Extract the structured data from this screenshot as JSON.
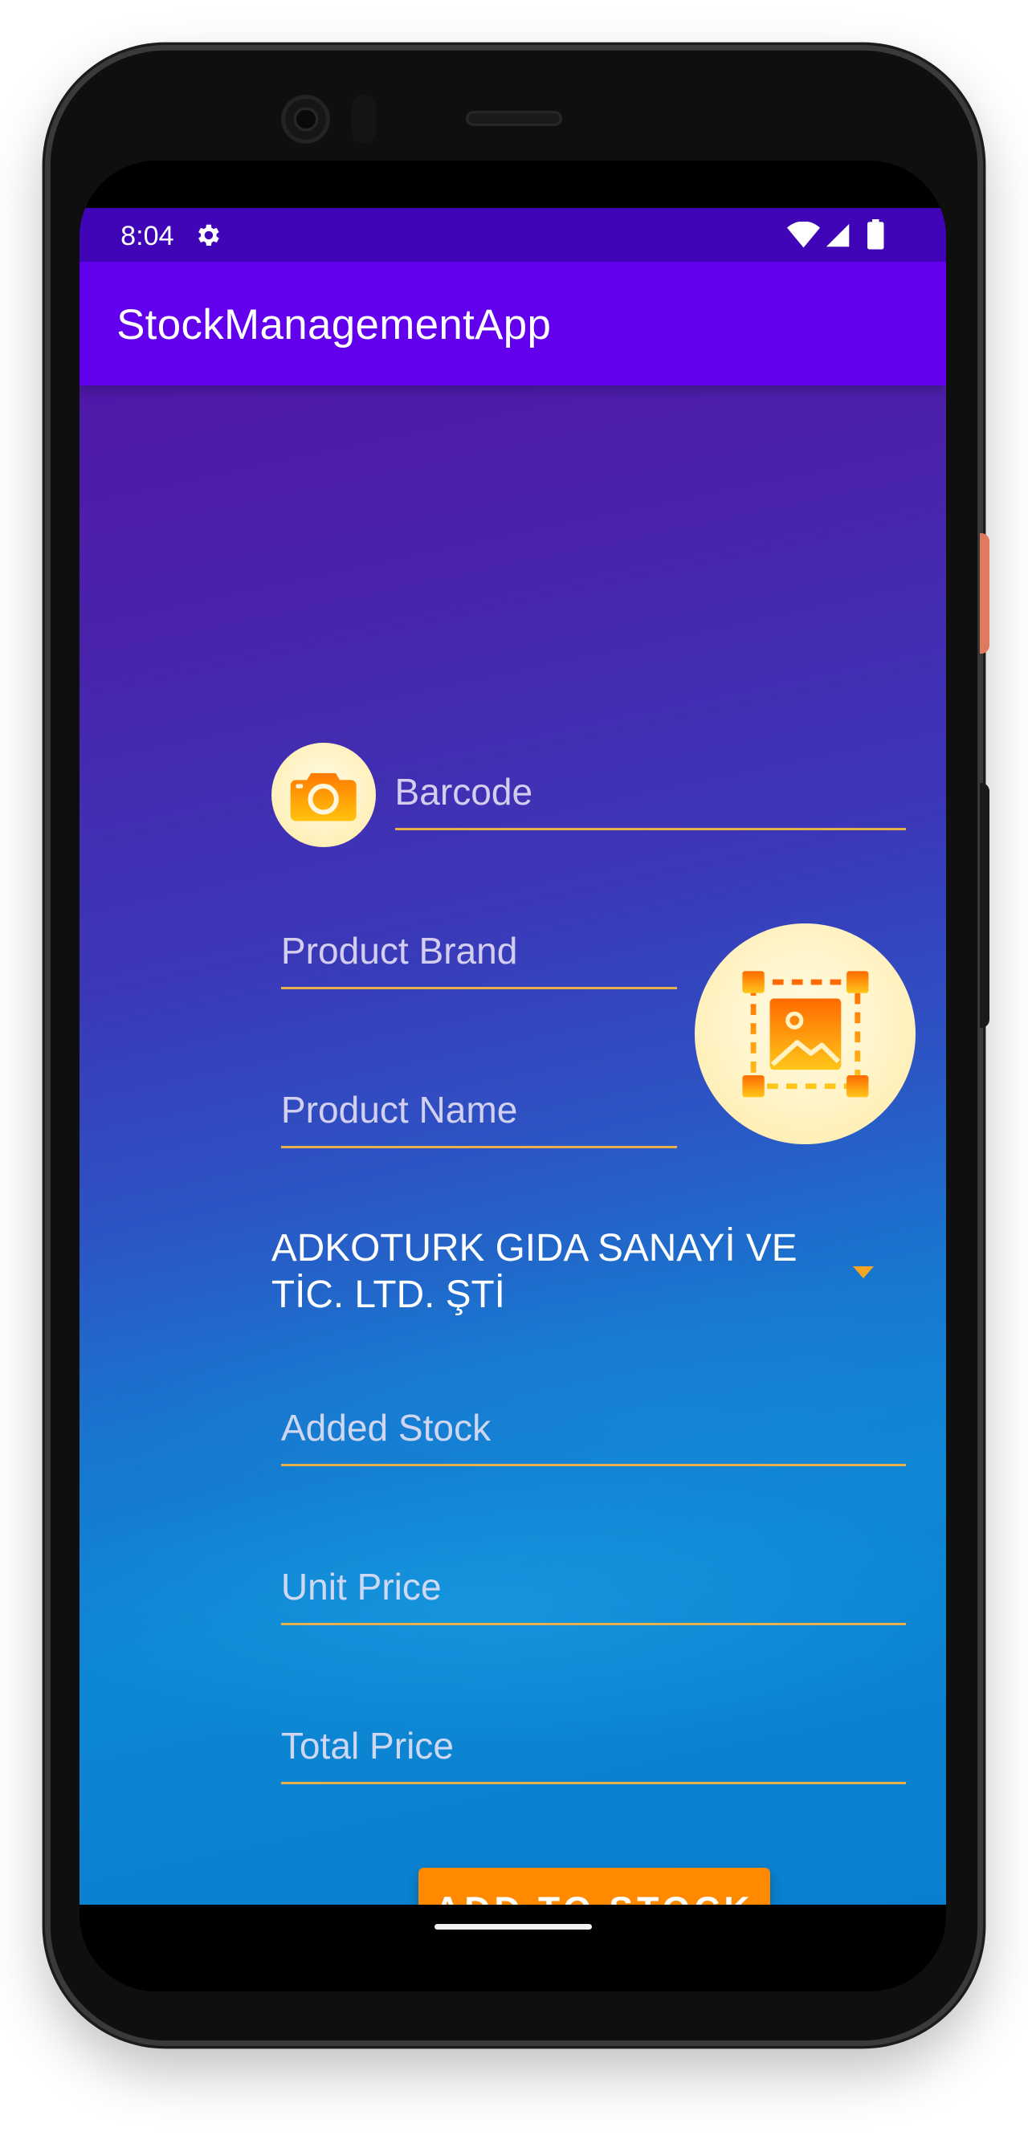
{
  "status_bar": {
    "time": "8:04",
    "icons": [
      "gear-icon",
      "wifi-icon",
      "signal-icon",
      "battery-icon"
    ]
  },
  "app_bar": {
    "title": "StockManagementApp",
    "color": "#6200ee"
  },
  "form": {
    "barcode": {
      "placeholder": "Barcode",
      "icon": "camera-icon"
    },
    "product_brand": {
      "placeholder": "Product Brand"
    },
    "product_name": {
      "placeholder": "Product Name"
    },
    "image_picker": {
      "icon": "image-select-icon"
    },
    "company_spinner": {
      "selected": "ADKOTURK GIDA SANAYİ VE TİC. LTD. ŞTİ"
    },
    "added_stock": {
      "placeholder": "Added Stock"
    },
    "unit_price": {
      "placeholder": "Unit Price"
    },
    "total_price": {
      "placeholder": "Total Price"
    },
    "submit": {
      "label": "ADD TO STOCK",
      "color": "#ff8a00"
    }
  },
  "colors": {
    "underline": "#e8b04a",
    "status_bar": "#3f05b6"
  }
}
